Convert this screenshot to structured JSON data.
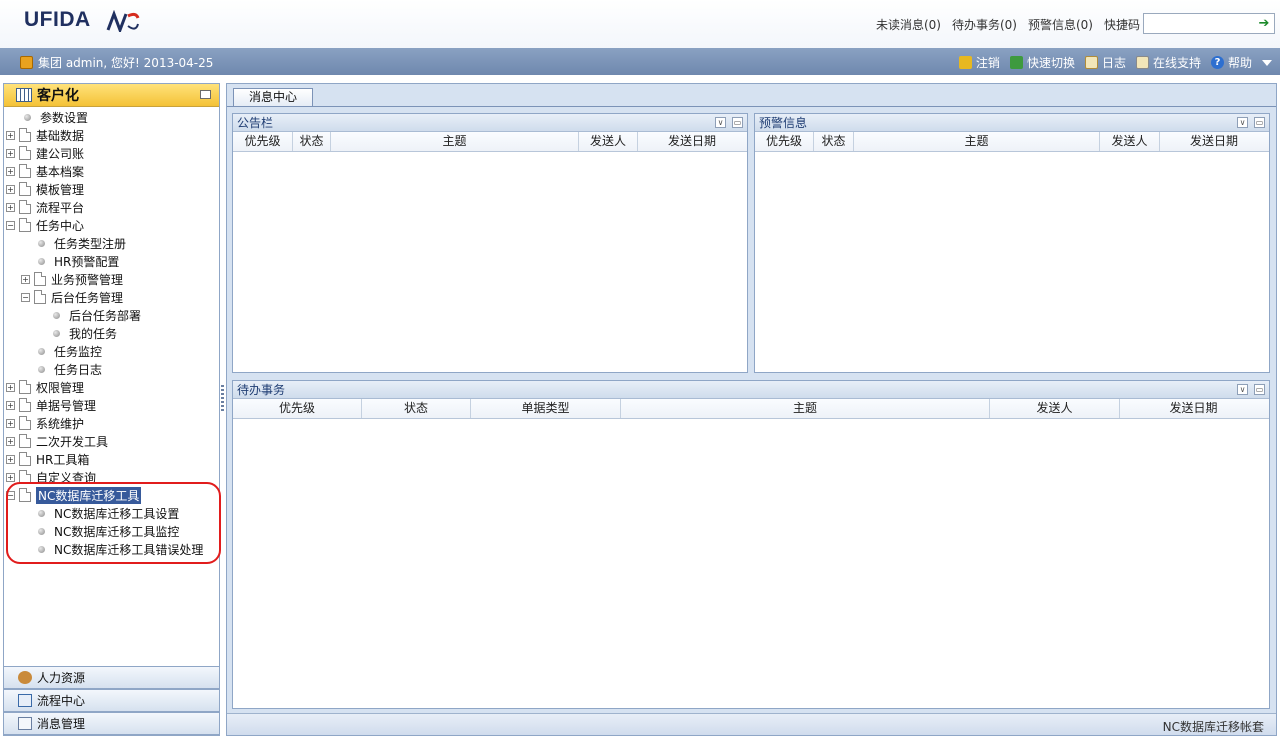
{
  "header": {
    "logo_text": "UFIDA",
    "links": [
      "未读消息(0)",
      "待办事务(0)",
      "预警信息(0)",
      "快捷码"
    ],
    "quick_input_value": ""
  },
  "userbar": {
    "greeting": "集团 admin, 您好! 2013-04-25",
    "actions": {
      "logout": "注销",
      "quick_switch": "快速切换",
      "log": "日志",
      "online_support": "在线支持",
      "help": "帮助"
    }
  },
  "left_panel": {
    "title": "客户化",
    "tree": [
      {
        "label": "参数设置"
      },
      {
        "label": "基础数据"
      },
      {
        "label": "建公司账"
      },
      {
        "label": "基本档案"
      },
      {
        "label": "模板管理"
      },
      {
        "label": "流程平台"
      },
      {
        "label": "任务中心"
      },
      {
        "label": "任务类型注册"
      },
      {
        "label": "HR预警配置"
      },
      {
        "label": "业务预警管理"
      },
      {
        "label": "后台任务管理"
      },
      {
        "label": "后台任务部署"
      },
      {
        "label": "我的任务"
      },
      {
        "label": "任务监控"
      },
      {
        "label": "任务日志"
      },
      {
        "label": "权限管理"
      },
      {
        "label": "单据号管理"
      },
      {
        "label": "系统维护"
      },
      {
        "label": "二次开发工具"
      },
      {
        "label": "HR工具箱"
      },
      {
        "label": "自定义查询"
      },
      {
        "label": "NC数据库迁移工具"
      },
      {
        "label": "NC数据库迁移工具设置"
      },
      {
        "label": "NC数据库迁移工具监控"
      },
      {
        "label": "NC数据库迁移工具错误处理"
      }
    ],
    "accordion": [
      "人力资源",
      "流程中心",
      "消息管理"
    ]
  },
  "main": {
    "tab": "消息中心",
    "bulletin": {
      "title": "公告栏",
      "columns": [
        "优先级",
        "状态",
        "主题",
        "发送人",
        "发送日期"
      ]
    },
    "alerts": {
      "title": "预警信息",
      "columns": [
        "优先级",
        "状态",
        "主题",
        "发送人",
        "发送日期"
      ]
    },
    "todo": {
      "title": "待办事务",
      "columns": [
        "优先级",
        "状态",
        "单据类型",
        "主题",
        "发送人",
        "发送日期"
      ]
    },
    "status_text": "NC数据库迁移帐套"
  },
  "colors": {
    "accent": "#375a9b",
    "highlight": "#e11c1c",
    "bar": "#7a91b4"
  }
}
